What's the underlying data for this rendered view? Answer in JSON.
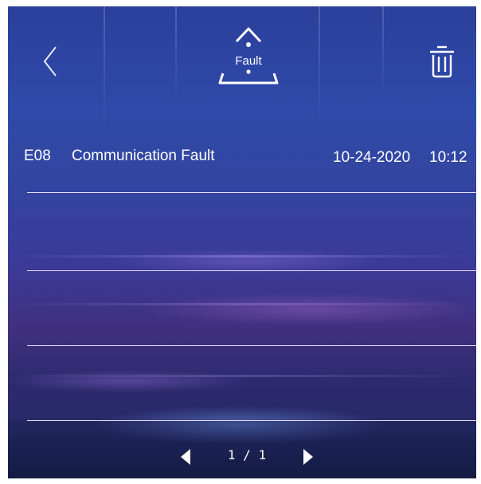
{
  "header": {
    "back_icon": "chevron-left-icon",
    "title_icon": "fault-warning-triangle-icon",
    "title": "Fault",
    "delete_icon": "trash-icon"
  },
  "faults": [
    {
      "code": "E08",
      "description": "Communication Fault",
      "date": "10-24-2020",
      "time": "10:12"
    }
  ],
  "pagination": {
    "prev_icon": "triangle-left-icon",
    "page_indicator": "1 / 1",
    "next_icon": "triangle-right-icon"
  },
  "colors": {
    "text": "#ffffff",
    "divider": "#f0e6ff"
  }
}
